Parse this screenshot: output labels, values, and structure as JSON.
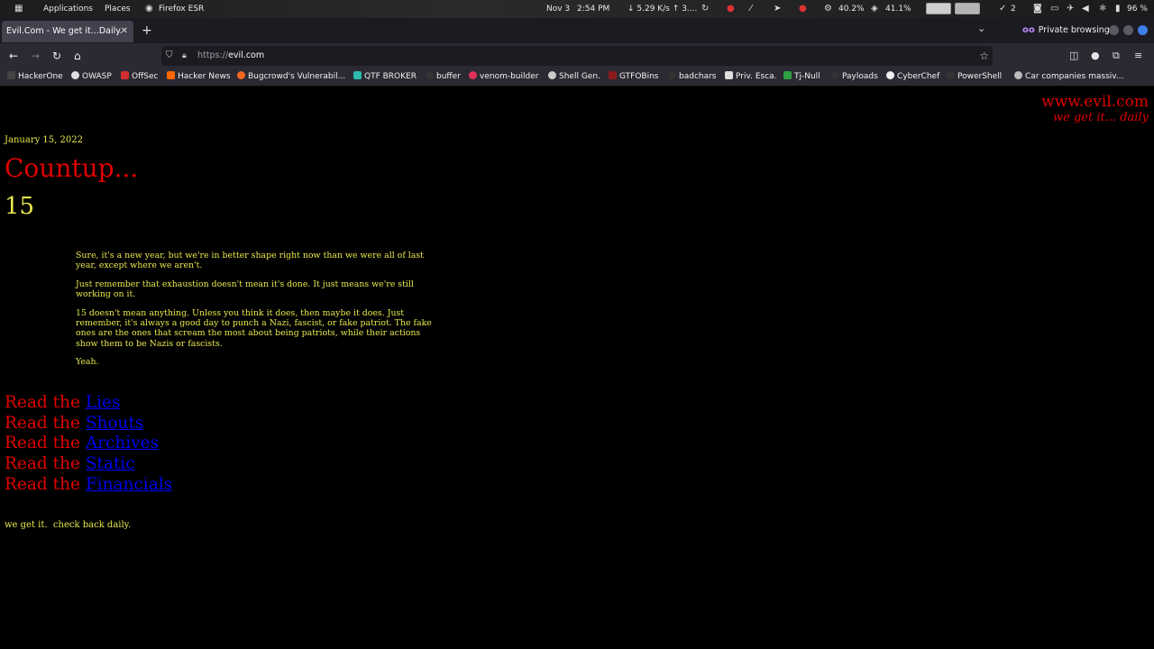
{
  "system_panel": {
    "applications_label": "Applications",
    "places_label": "Places",
    "app_label": "Firefox ESR",
    "date": "Nov 3",
    "time": "2:54 PM",
    "network": "↓ 5.29 K/s ↑ 3....",
    "cpu": "40.2%",
    "memory": "41.1%",
    "tasks": "2",
    "battery": "96 %"
  },
  "tab": {
    "title": "Evil.Com - We get it...Daily."
  },
  "window": {
    "private_label": "Private browsing"
  },
  "nav": {
    "url_scheme": "https://",
    "url_host": "evil.com"
  },
  "bookmarks": [
    {
      "label": "HackerOne",
      "color": "#444444"
    },
    {
      "label": "OWASP",
      "color": "#e0e0e0"
    },
    {
      "label": "OffSec",
      "color": "#d03030"
    },
    {
      "label": "Hacker News",
      "color": "#ff6600"
    },
    {
      "label": "Bugcrowd's Vulnerabil...",
      "color": "#f26822"
    },
    {
      "label": "QTF BROKER",
      "color": "#2bbbad"
    },
    {
      "label": "buffer",
      "color": "#333333"
    },
    {
      "label": "venom-builder",
      "color": "#e0315b"
    },
    {
      "label": "Shell Gen.",
      "color": "#cccccc"
    },
    {
      "label": "GTFOBins",
      "color": "#8b1a1a"
    },
    {
      "label": "badchars",
      "color": "#333333"
    },
    {
      "label": "Priv. Esca.",
      "color": "#dddddd"
    },
    {
      "label": "Tj-Null",
      "color": "#2ea043"
    },
    {
      "label": "Payloads",
      "color": "#333333"
    },
    {
      "label": "CyberChef",
      "color": "#eeeeee"
    },
    {
      "label": "PowerShell",
      "color": "#333333"
    },
    {
      "label": "Car companies massiv...",
      "color": "#bbbbbb"
    }
  ],
  "page": {
    "site_name": "www.evil.com",
    "site_tagline": "we get it... daily",
    "date": "January 15, 2022",
    "title": "Countup...",
    "number": "15",
    "paragraphs": [
      "Sure, it's a new year, but we're in better shape right now than we were all of last year, except where we aren't.",
      "Just remember that exhaustion doesn't mean it's done. It just means we're still working on it.",
      "15 doesn't mean anything. Unless you think it does, then maybe it does. Just remember, it's always a good day to punch a Nazi, fascist, or fake patriot. The fake ones are the ones that scream the most about being patriots, while their actions show them to be Nazis or fascists.",
      "Yeah."
    ],
    "read_prefix": "Read the ",
    "read_links": [
      "Lies",
      "Shouts",
      "Archives",
      "Static",
      "Financials"
    ],
    "footer": "we get it.  check back daily.",
    "colors": {
      "background": "#000000",
      "accent_red": "#e00000",
      "text_yellow": "#e8e84c",
      "link_blue": "#0000ee"
    }
  }
}
